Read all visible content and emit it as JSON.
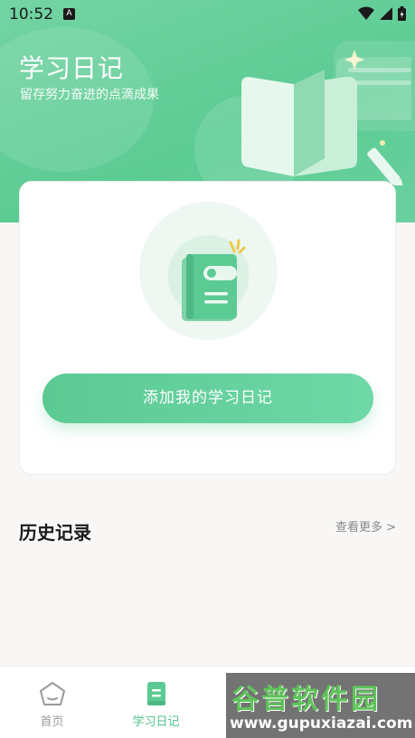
{
  "status_bar": {
    "time": "10:52",
    "badge": "A"
  },
  "header": {
    "title": "学习日记",
    "subtitle": "留存努力奋进的点滴成果"
  },
  "card": {
    "add_button_label": "添加我的学习日记"
  },
  "history": {
    "title": "历史记录",
    "see_more": "查看更多 >"
  },
  "bottom_nav": [
    {
      "label": "首页",
      "icon": "home-icon",
      "active": false
    },
    {
      "label": "学习日记",
      "icon": "diary-icon",
      "active": true
    }
  ],
  "watermark": {
    "title": "谷普软件园",
    "url": "www.gupuxiazai.com"
  },
  "colors": {
    "accent": "#5ccb93",
    "accent_light": "#e9f7ef",
    "nav_active": "#4fc48a",
    "nav_inactive": "#999999"
  }
}
